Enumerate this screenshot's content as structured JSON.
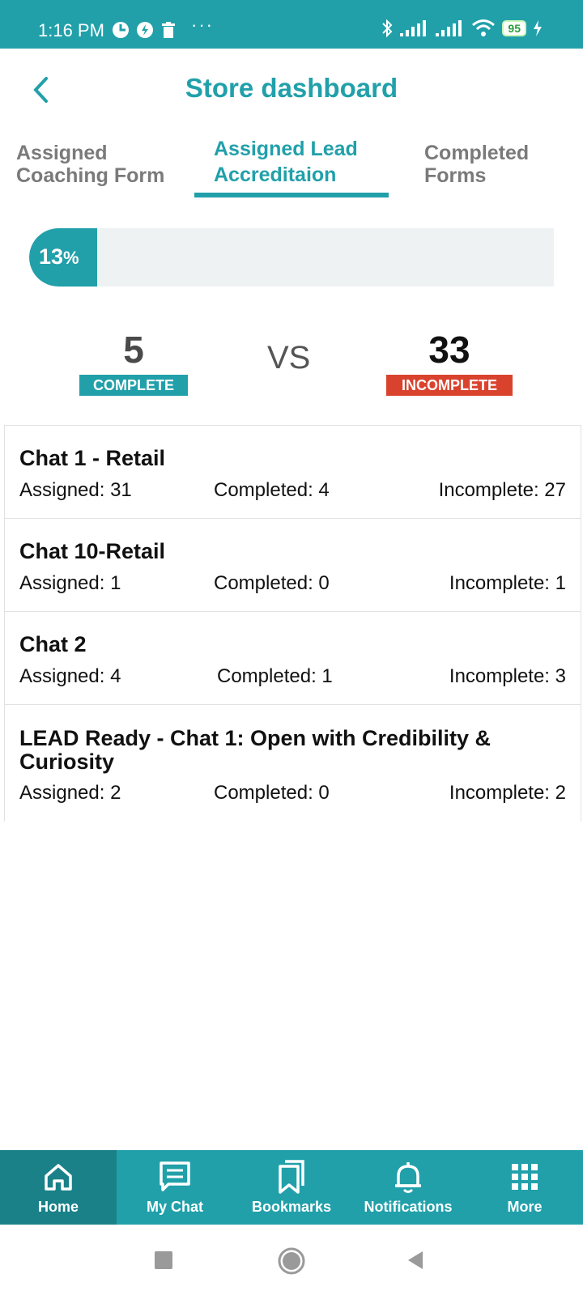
{
  "status_bar": {
    "time": "1:16 PM",
    "ellipsis": "···",
    "battery": "95"
  },
  "header": {
    "title": "Store dashboard"
  },
  "tabs": [
    {
      "line1": "Assigned",
      "line2": "Coaching Form"
    },
    {
      "line1": "Assigned Lead",
      "line2": "Accreditaion"
    },
    {
      "line1": "Completed",
      "line2": "Forms"
    }
  ],
  "progress": {
    "label": "13",
    "suffix": "%",
    "fraction": 0.13,
    "fill_color": "#21a0aa"
  },
  "summary": {
    "complete_count": "5",
    "complete_label": "COMPLETE",
    "complete_color": "#21a0aa",
    "vs": "VS",
    "incomplete_count": "33",
    "incomplete_label": "INCOMPLETE",
    "incomplete_color": "#d9432e"
  },
  "items": [
    {
      "title": "Chat 1 - Retail",
      "assigned": "Assigned: 31",
      "completed": "Completed: 4",
      "incomplete": "Incomplete: 27"
    },
    {
      "title": "Chat 10-Retail",
      "assigned": "Assigned: 1",
      "completed": "Completed: 0",
      "incomplete": "Incomplete: 1"
    },
    {
      "title": "Chat 2",
      "assigned": "Assigned: 4",
      "completed": "Completed: 1",
      "incomplete": "Incomplete: 3"
    },
    {
      "title_line1": "LEAD Ready - Chat 1: Open with Credibility &",
      "title_line2": "Curiosity",
      "assigned": "Assigned: 2",
      "completed": "Completed: 0",
      "incomplete": "Incomplete: 2"
    }
  ],
  "bottom_nav": [
    {
      "label": "Home",
      "icon": "home-icon"
    },
    {
      "label": "My Chat",
      "icon": "chat-icon"
    },
    {
      "label": "Bookmarks",
      "icon": "bookmarks-icon"
    },
    {
      "label": "Notifications",
      "icon": "bell-icon"
    },
    {
      "label": "More",
      "icon": "grid-icon"
    }
  ],
  "colors": {
    "brand": "#21a0aa",
    "brand_dark": "#1a8189"
  }
}
